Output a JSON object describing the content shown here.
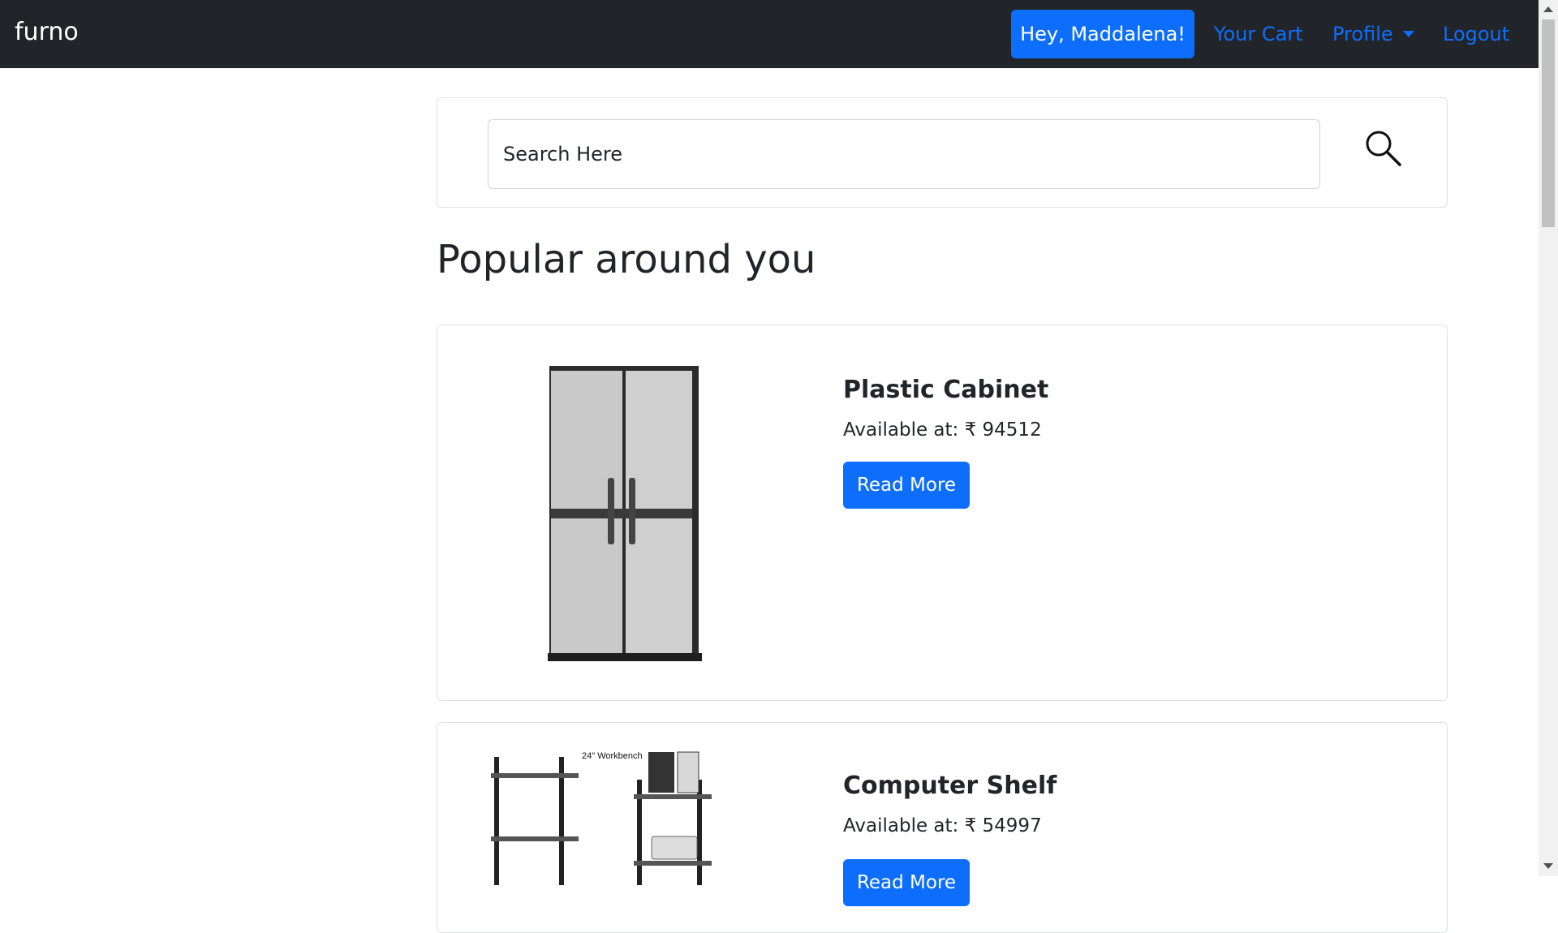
{
  "nav": {
    "brand": "furno",
    "greeting": "Hey, Maddalena!",
    "cart": "Your Cart",
    "profile": "Profile",
    "logout": "Logout"
  },
  "search": {
    "placeholder": "Search Here"
  },
  "section_title": "Popular around you",
  "products": [
    {
      "name": "Plastic Cabinet",
      "price": "Available at: ₹ 94512",
      "button": "Read More"
    },
    {
      "name": "Computer Shelf",
      "price": "Available at: ₹ 54997",
      "button": "Read More",
      "image_caption": "24\" Workbench"
    }
  ],
  "colors": {
    "navbar": "#212529",
    "primary": "#0d6efd",
    "border": "#dee2e6"
  }
}
